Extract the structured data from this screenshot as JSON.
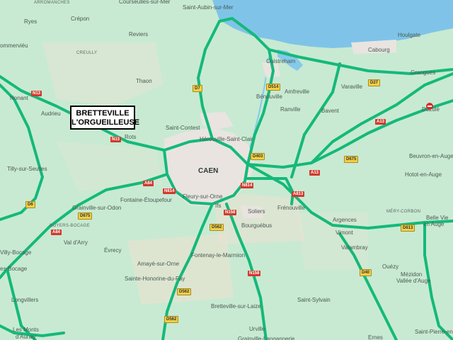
{
  "callout": {
    "line1": "BRETTEVILLE",
    "line2": "L'ORGUEILLEUSE"
  },
  "city": "CAEN",
  "places": [
    {
      "key": "p1",
      "name": "ARROMANCHES",
      "small": true
    },
    {
      "key": "p2",
      "name": "Courseulles-sur-Mer"
    },
    {
      "key": "p3",
      "name": "Saint-Aubin-sur-Mer"
    },
    {
      "key": "p4",
      "name": "Crépon"
    },
    {
      "key": "p5",
      "name": "Ryes"
    },
    {
      "key": "p6",
      "name": "ommerviéu"
    },
    {
      "key": "p7",
      "name": "CREULLY",
      "small": true
    },
    {
      "key": "p8",
      "name": "Reviers"
    },
    {
      "key": "p9",
      "name": "Thaon"
    },
    {
      "key": "p10",
      "name": "Nonant"
    },
    {
      "key": "p11",
      "name": "Audrieu"
    },
    {
      "key": "p12",
      "name": "Rots"
    },
    {
      "key": "p13",
      "name": "Saint-Contest"
    },
    {
      "key": "p14",
      "name": "Hérouville-Saint-Clair"
    },
    {
      "key": "p15",
      "name": "Bénouville"
    },
    {
      "key": "p16",
      "name": "Ouistreham"
    },
    {
      "key": "p17",
      "name": "Amfreville"
    },
    {
      "key": "p18",
      "name": "Ranville"
    },
    {
      "key": "p19",
      "name": "Bavent"
    },
    {
      "key": "p20",
      "name": "Varaville"
    },
    {
      "key": "p21",
      "name": "Cabourg"
    },
    {
      "key": "p22",
      "name": "Houlgate"
    },
    {
      "key": "p23",
      "name": "Grangues"
    },
    {
      "key": "p24",
      "name": "Dozulé"
    },
    {
      "key": "p25",
      "name": "Beuvron-en-Auge"
    },
    {
      "key": "p26",
      "name": "Hotot-en-Auge"
    },
    {
      "key": "p27",
      "name": "Tilly-sur-Seulles"
    },
    {
      "key": "p28",
      "name": "Fontaine-Étoupefour"
    },
    {
      "key": "p29",
      "name": "Fleury-sur-Orne"
    },
    {
      "key": "p30",
      "name": "Ifs"
    },
    {
      "key": "p31",
      "name": "Soliers"
    },
    {
      "key": "p32",
      "name": "Frénouville"
    },
    {
      "key": "p33",
      "name": "Bourguébus"
    },
    {
      "key": "p34",
      "name": "Argences"
    },
    {
      "key": "p35",
      "name": "MÉRY-CORBON",
      "small": true
    },
    {
      "key": "p36",
      "name": "Belle Vie"
    },
    {
      "key": "p37",
      "name": "en Auge"
    },
    {
      "key": "p38",
      "name": "Grainville-sur-Odon"
    },
    {
      "key": "p39",
      "name": "NOYERS-BOCAGE",
      "small": true
    },
    {
      "key": "p40",
      "name": "Val d'Arry"
    },
    {
      "key": "p41",
      "name": "Évrecy"
    },
    {
      "key": "p42",
      "name": "Amayé-sur-Orne"
    },
    {
      "key": "p43",
      "name": "Fontenay-le-Marmion"
    },
    {
      "key": "p44",
      "name": "Vimont"
    },
    {
      "key": "p45",
      "name": "Valambray"
    },
    {
      "key": "p46",
      "name": "Villy-Bocage"
    },
    {
      "key": "p47",
      "name": "es-Bocage"
    },
    {
      "key": "p48",
      "name": "Sainte-Honorine-du-Fay"
    },
    {
      "key": "p49",
      "name": "Ouézy"
    },
    {
      "key": "p50",
      "name": "Mézidon"
    },
    {
      "key": "p51",
      "name": "Vallée d'Auge"
    },
    {
      "key": "p52",
      "name": "Longvillers"
    },
    {
      "key": "p53",
      "name": "Bretteville-sur-Laize"
    },
    {
      "key": "p54",
      "name": "Saint-Sylvain"
    },
    {
      "key": "p55",
      "name": "Les Monts"
    },
    {
      "key": "p56",
      "name": "d'Aunay"
    },
    {
      "key": "p57",
      "name": "Urville"
    },
    {
      "key": "p58",
      "name": "Grainville-Langannerie"
    },
    {
      "key": "p59",
      "name": "Ernes"
    },
    {
      "key": "p60",
      "name": "Saint-Pierre-en-"
    }
  ],
  "shields": [
    {
      "key": "s1",
      "label": "N13",
      "color": "red"
    },
    {
      "key": "s2",
      "label": "N13",
      "color": "red"
    },
    {
      "key": "s3",
      "label": "D7",
      "color": "yellow"
    },
    {
      "key": "s4",
      "label": "D514",
      "color": "yellow"
    },
    {
      "key": "s5",
      "label": "D27",
      "color": "yellow"
    },
    {
      "key": "s6",
      "label": "A13",
      "color": "red"
    },
    {
      "key": "s7",
      "label": "D675",
      "color": "yellow"
    },
    {
      "key": "s8",
      "label": "D403",
      "color": "yellow"
    },
    {
      "key": "s9",
      "label": "A13",
      "color": "red"
    },
    {
      "key": "s10",
      "label": "A813",
      "color": "red"
    },
    {
      "key": "s11",
      "label": "A84",
      "color": "red"
    },
    {
      "key": "s12",
      "label": "N814",
      "color": "red"
    },
    {
      "key": "s13",
      "label": "N814",
      "color": "red"
    },
    {
      "key": "s14",
      "label": "D675",
      "color": "yellow"
    },
    {
      "key": "s15",
      "label": "D562",
      "color": "yellow"
    },
    {
      "key": "s16",
      "label": "N158",
      "color": "red"
    },
    {
      "key": "s17",
      "label": "A84",
      "color": "red"
    },
    {
      "key": "s18",
      "label": "D6",
      "color": "yellow"
    },
    {
      "key": "s19",
      "label": "D613",
      "color": "yellow"
    },
    {
      "key": "s20",
      "label": "D40",
      "color": "yellow"
    },
    {
      "key": "s21",
      "label": "N158",
      "color": "red"
    },
    {
      "key": "s22",
      "label": "D562",
      "color": "yellow"
    },
    {
      "key": "s23",
      "label": "D562",
      "color": "yellow"
    }
  ],
  "colors": {
    "land": "#c8ead2",
    "sea": "#7fc4e8",
    "road": "#14b97a",
    "urban": "#e9e4e0",
    "field": "#efe0d0"
  }
}
